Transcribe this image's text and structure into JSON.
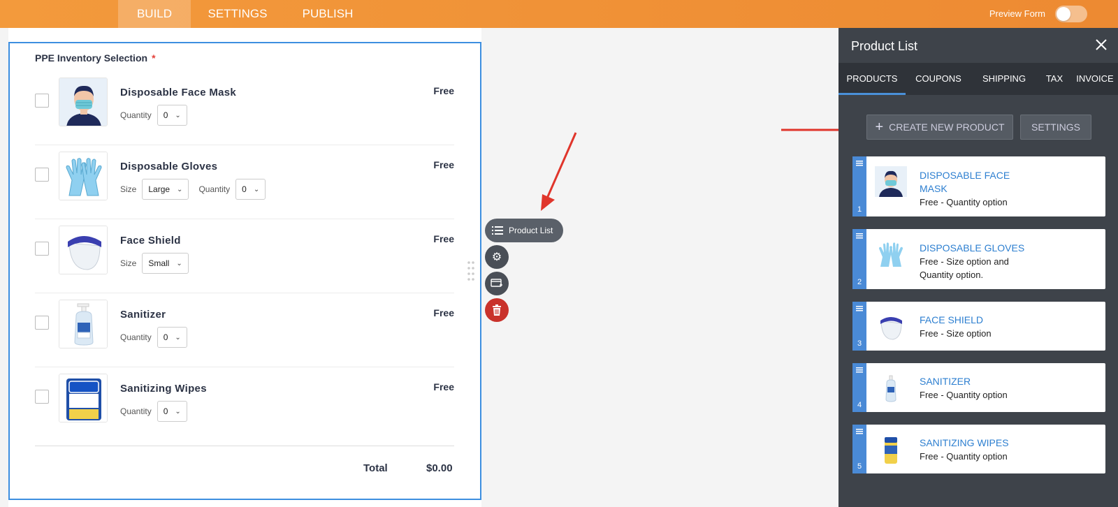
{
  "topbar": {
    "tabs": [
      {
        "label": "BUILD",
        "active": true
      },
      {
        "label": "SETTINGS",
        "active": false
      },
      {
        "label": "PUBLISH",
        "active": false
      }
    ],
    "preview_label": "Preview Form",
    "preview_on": false
  },
  "form": {
    "field_title": "PPE Inventory Selection",
    "required_mark": "*",
    "products": [
      {
        "name": "Disposable Face Mask",
        "price": "Free",
        "icon": "face-mask-image",
        "options": [
          {
            "label": "Quantity",
            "value": "0"
          }
        ]
      },
      {
        "name": "Disposable Gloves",
        "price": "Free",
        "icon": "gloves-image",
        "options": [
          {
            "label": "Size",
            "value": "Large"
          },
          {
            "label": "Quantity",
            "value": "0"
          }
        ]
      },
      {
        "name": "Face Shield",
        "price": "Free",
        "icon": "face-shield-image",
        "options": [
          {
            "label": "Size",
            "value": "Small"
          }
        ]
      },
      {
        "name": "Sanitizer",
        "price": "Free",
        "icon": "sanitizer-image",
        "options": [
          {
            "label": "Quantity",
            "value": "0"
          }
        ]
      },
      {
        "name": "Sanitizing Wipes",
        "price": "Free",
        "icon": "wipes-image",
        "options": [
          {
            "label": "Quantity",
            "value": "0"
          }
        ]
      }
    ],
    "total_label": "Total",
    "total_value": "$0.00"
  },
  "toolbar": {
    "product_list_label": "Product List",
    "icons": [
      "list-icon",
      "gear-icon",
      "payment-card-icon",
      "trash-icon"
    ]
  },
  "panel": {
    "title": "Product List",
    "tabs": [
      {
        "label": "PRODUCTS",
        "active": true
      },
      {
        "label": "COUPONS",
        "active": false
      },
      {
        "label": "SHIPPING",
        "active": false
      },
      {
        "label": "TAX",
        "active": false
      },
      {
        "label": "INVOICE",
        "active": false
      }
    ],
    "create_label": "CREATE NEW PRODUCT",
    "settings_label": "SETTINGS",
    "items": [
      {
        "num": "1",
        "name": "DISPOSABLE FACE MASK",
        "desc": "Free - Quantity option"
      },
      {
        "num": "2",
        "name": "DISPOSABLE GLOVES",
        "desc": "Free - Size option and Quantity option."
      },
      {
        "num": "3",
        "name": "FACE SHIELD",
        "desc": "Free - Size option"
      },
      {
        "num": "4",
        "name": "SANITIZER",
        "desc": "Free - Quantity option"
      },
      {
        "num": "5",
        "name": "SANITIZING WIPES",
        "desc": "Free - Quantity option"
      }
    ]
  },
  "colors": {
    "topbar": "#ee8e35",
    "panel_bg": "#3e434a",
    "accent_blue": "#4a8ad6",
    "link_blue": "#2d7fd0",
    "arrow_red": "#e0352b",
    "delete_red": "#c9322b"
  }
}
